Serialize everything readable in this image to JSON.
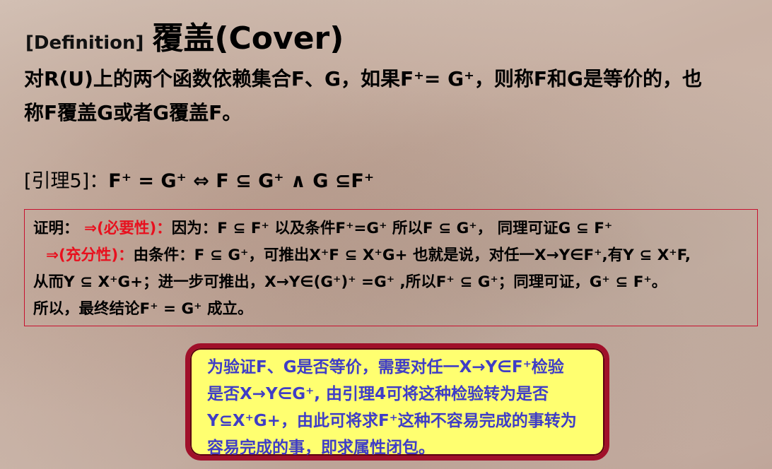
{
  "header": {
    "definition_tag": "[Definition]",
    "title": "覆盖(Cover)"
  },
  "definition": {
    "line1": "对R(U)上的两个函数依赖集合F、G，如果F⁺= G⁺，则称F和G是等价的，也",
    "line2": "称F覆盖G或者G覆盖F。"
  },
  "lemma": {
    "label": "[引理5]：",
    "statement": "F⁺ = G⁺ ⇔ F ⊆ G⁺ ∧ G ⊆F⁺"
  },
  "proof": {
    "label": "证明：",
    "necessity_label": "⇒(必要性)：",
    "necessity_text": "因为：F ⊆ F⁺ 以及条件F⁺=G⁺ 所以F ⊆ G⁺，  同理可证G ⊆ F⁺",
    "sufficiency_label": "⇒(充分性)：",
    "sufficiency_text": "由条件：F ⊆ G⁺，可推出X⁺F ⊆ X⁺G+  也就是说，对任一X→Y∈F⁺,有Y ⊆ X⁺F,",
    "line3": "从而Y ⊆ X⁺G+；进一步可推出，X→Y∈(G⁺)⁺ =G⁺ ,所以F⁺ ⊆ G⁺；同理可证，G⁺ ⊆ F⁺。",
    "line4": "所以，最终结论F⁺ = G⁺ 成立。"
  },
  "note": {
    "line1": "为验证F、G是否等价，需要对任一X→Y∈F⁺检验",
    "line2": "是否X→Y∈G⁺, 由引理4可将这种检验转为是否",
    "line3": "Y⊆X⁺G+，由此可将求F⁺这种不容易完成的事转为",
    "line4": "容易完成的事，即求属性闭包。"
  }
}
